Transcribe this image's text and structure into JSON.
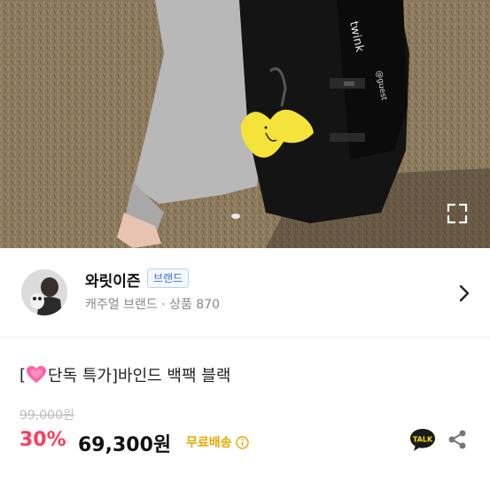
{
  "hero": {
    "image_desc": "product-photo-backpack",
    "expand_icon": "expand-icon"
  },
  "shop": {
    "name": "와릿이즌",
    "badge": "브랜드",
    "subtitle": "캐주얼 브랜드 · 상품 870",
    "chevron_icon": "chevron-right-icon"
  },
  "product": {
    "title_open": "[",
    "title_rest": "단독 특가]바인드 백팩 블랙",
    "original_price": "99,000원",
    "discount": "30%",
    "price": "69,300원",
    "shipping": "무료배송",
    "talk_label": "TALK"
  },
  "colors": {
    "discount": "#ff3b5c",
    "shipping": "#e6a800",
    "brand_badge": "#3b6fd8"
  }
}
